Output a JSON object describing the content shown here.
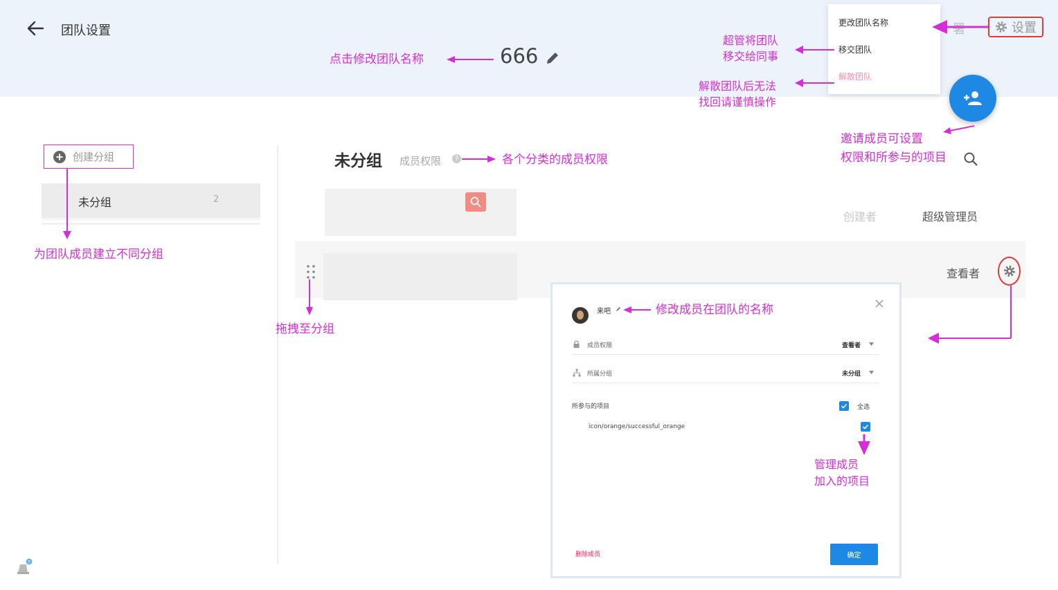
{
  "header": {
    "page_title": "团队设置",
    "team_name": "666",
    "behind_text": "署",
    "settings_label": "设置"
  },
  "dropdown_menu": {
    "rename": "更改团队名称",
    "transfer": "移交团队",
    "dissolve": "解散团队"
  },
  "sidebar": {
    "create_group_label": "创建分组",
    "group_name": "未分组",
    "group_count": "2"
  },
  "content": {
    "section_title": "未分组",
    "member_permission_label": "成员权限",
    "help_glyph": "?",
    "creator_role": "创建者",
    "super_admin_role": "超级管理员",
    "viewer_role": "查看者"
  },
  "dialog": {
    "member_name": "来吧",
    "permission_label": "成员权限",
    "permission_value": "查看者",
    "group_label": "所属分组",
    "group_value": "未分组",
    "projects_label": "所参与的项目",
    "select_all_label": "全选",
    "project_name": "icon/orange/successful_orange",
    "delete_member": "删除成员",
    "confirm": "确定"
  },
  "annotations": {
    "rename_team": "点击修改团队名称",
    "transfer_line1": "超管将团队",
    "transfer_line2": "移交给同事",
    "dissolve_line1": "解散团队后无法",
    "dissolve_line2": "找回请谨慎操作",
    "invite_line1": "邀请成员可设置",
    "invite_line2": "权限和所参与的项目",
    "group_permission": "各个分类的成员权限",
    "create_groups": "为团队成员建立不同分组",
    "drag_to_group": "拖拽至分组",
    "rename_member": "修改成员在团队的名称",
    "manage_line1": "管理成员",
    "manage_line2": "加入的项目"
  },
  "colors": {
    "annotation": "#d62ed6",
    "accent": "#1e88e5",
    "highlight_border": "#e53935",
    "header_bg": "#edf3fb"
  },
  "icons": [
    "arrow-left-icon",
    "pencil-icon",
    "gear-icon",
    "add-person-icon",
    "plus-circle-icon",
    "help-icon",
    "search-icon",
    "drag-handle-icon",
    "avatar",
    "lock-icon",
    "hierarchy-icon",
    "check-icon",
    "close-icon",
    "bell-icon"
  ]
}
